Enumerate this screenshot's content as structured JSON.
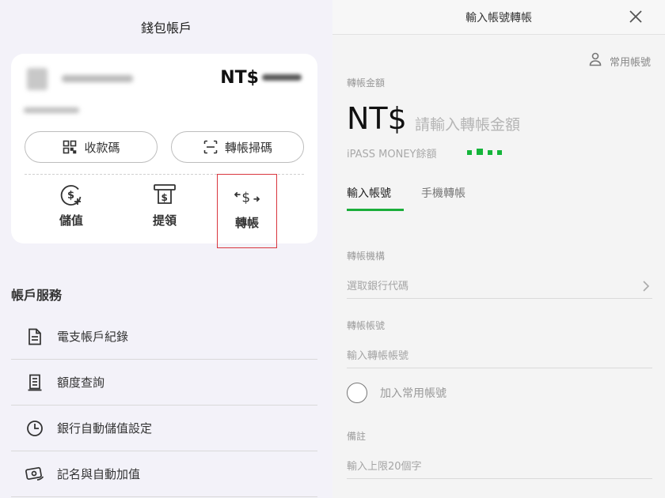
{
  "left": {
    "title": "錢包帳戶",
    "card": {
      "currency": "NT$",
      "receive_label": "收款碼",
      "scan_label": "轉帳掃碼",
      "actions": [
        {
          "label": "儲值",
          "icon": "dollar-plus-icon"
        },
        {
          "label": "提領",
          "icon": "cash-withdraw-icon"
        },
        {
          "label": "轉帳",
          "icon": "transfer-arrows-icon"
        }
      ]
    },
    "section_title": "帳戶服務",
    "menu": [
      {
        "label": "電支帳戶紀錄",
        "icon": "document-icon"
      },
      {
        "label": "額度查詢",
        "icon": "receipt-icon"
      },
      {
        "label": "銀行自動儲值設定",
        "icon": "clock-icon"
      },
      {
        "label": "記名與自動加值",
        "icon": "card-hand-icon"
      }
    ]
  },
  "right": {
    "title": "輸入帳號轉帳",
    "favorites_label": "常用帳號",
    "amount_label": "轉帳金額",
    "currency": "NT$",
    "amount_placeholder": "請輸入轉帳金額",
    "ipass_label": "iPASS MONEY餘額",
    "tabs": [
      {
        "label": "輸入帳號",
        "active": true
      },
      {
        "label": "手機轉帳",
        "active": false
      }
    ],
    "institution_label": "轉帳機構",
    "institution_placeholder": "選取銀行代碼",
    "account_label": "轉帳帳號",
    "account_placeholder": "輸入轉帳帳號",
    "add_favorite_label": "加入常用帳號",
    "note_label": "備註",
    "note_placeholder": "輸入上限20個字"
  },
  "colors": {
    "accent_green": "#1aae3a",
    "highlight_red": "#d9363e",
    "left_background": "#f3f2f9"
  }
}
